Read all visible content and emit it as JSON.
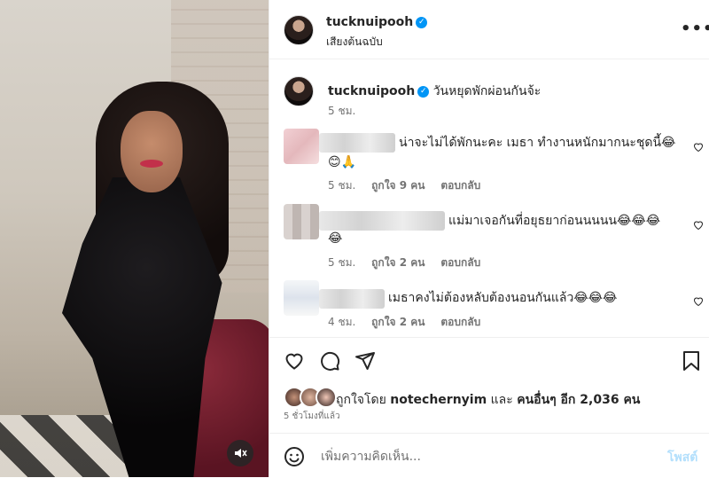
{
  "post": {
    "username": "tucknuipooh",
    "audio": "เสียงต้นฉบับ",
    "caption": "วันหยุดพักผ่อนกันจ้ะ",
    "caption_time": "5 ชม.",
    "more_label": "•••"
  },
  "comments": [
    {
      "text_line1": "น่าจะไม่ได้พักนะคะ เมธา ทำงานหนักมากนะชุดนี้😂",
      "text_line2": "😊🙏",
      "time": "5 ชม.",
      "likes": "ถูกใจ 9 คน",
      "reply": "ตอบกลับ"
    },
    {
      "text_line1": "แม่มาเจอกันที่อยุธยาก่อนนนนน😂😂😂",
      "text_line2": "😂",
      "time": "5 ชม.",
      "likes": "ถูกใจ 2 คน",
      "reply": "ตอบกลับ"
    },
    {
      "text_line1": "เมธาคงไม่ต้องหลับต้องนอนกันแล้ว😂😂😂",
      "text_line2": "",
      "time": "4 ชม.",
      "likes": "ถูกใจ 2 คน",
      "reply": "ตอบกลับ"
    }
  ],
  "likes": {
    "prefix": "ถูกใจโดย",
    "user": "notechernyim",
    "middle": "และ",
    "others": "คนอื่นๆ อีก 2,036 คน"
  },
  "post_time": "5 ชั่วโมงที่แล้ว",
  "comment_box": {
    "placeholder": "เพิ่มความคิดเห็น...",
    "post_label": "โพสต์"
  },
  "colors": {
    "verified": "#0095f6",
    "post_button": "#b2dffc",
    "muted_text": "#737373"
  }
}
